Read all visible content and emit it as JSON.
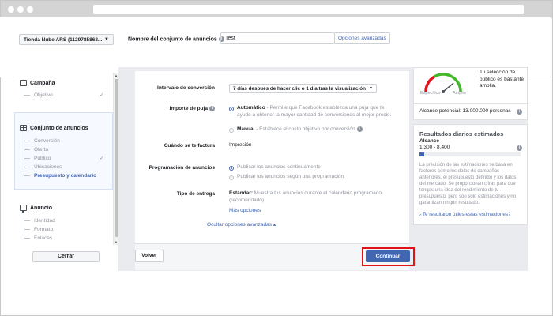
{
  "browser": {},
  "header": {
    "account_select": "Tienda Nube ARS (1129785863...",
    "set_name_label": "Nombre del conjunto de anuncios",
    "set_name_value": "Test",
    "advanced_options": "Opciones avanzadas"
  },
  "sidebar": {
    "campaign": {
      "title": "Campaña",
      "items": [
        "Objetivo"
      ]
    },
    "adset": {
      "title": "Conjunto de anuncios",
      "items": [
        "Conversión",
        "Oferta",
        "Público",
        "Ubicaciones",
        "Presupuesto y calendario"
      ]
    },
    "ad": {
      "title": "Anuncio",
      "items": [
        "Identidad",
        "Formato",
        "Enlaces"
      ]
    },
    "close_button": "Cerrar",
    "check_mark": "✓"
  },
  "form": {
    "conversion_window": {
      "label": "Intervalo de conversión",
      "value": "7 días después de hacer clic o 1 día tras la visualización"
    },
    "bid_amount": {
      "label": "Importe de puja",
      "auto_title": "Automático",
      "auto_desc": " - Permite que Facebook establezca una puja que te ayude a obtener la mayor cantidad de conversiones al mejor precio.",
      "manual_title": "Manual",
      "manual_desc": " - Establece el costo objetivo por conversión"
    },
    "billing": {
      "label": "Cuándo se te factura",
      "value": "Impresión"
    },
    "scheduling": {
      "label": "Programación de anuncios",
      "option1": "Publicar los anuncios continuamente",
      "option2": "Publicar los anuncios según una programación"
    },
    "delivery": {
      "label": "Tipo de entrega",
      "title": "Estándar:",
      "desc": " Muestra tus anuncios durante el calendario programado (recomendado)",
      "more": "Más opciones"
    },
    "hide_advanced": "Ocultar opciones avanzadas ▴"
  },
  "footer": {
    "back": "Volver",
    "continue": "Continuar"
  },
  "audience_panel": {
    "specific": "Específico",
    "broad": "Amplio",
    "description": "Tu selección de público es bastante amplia.",
    "potential_reach": "Alcance potencial: 13.000.000 personas",
    "gauge_level": 0.78
  },
  "results_panel": {
    "title": "Resultados diarios estimados",
    "reach_label": "Alcance",
    "reach_range": "1.300 - 8.400",
    "bar_fill": 0.05,
    "disclaimer": "La precisión de las estimaciones se basa en factores como los datos de campañas anteriores, el presupuesto definido y los datos del mercado. Se proporcionan cifras para que tengas una idea del rendimiento de tu presupuesto, pero son solo estimaciones y no garantizan ningún resultado.",
    "feedback": "¿Te resultaron útiles estas estimaciones?"
  },
  "colors": {
    "accent": "#4267b2",
    "highlight": "#e0131b"
  }
}
